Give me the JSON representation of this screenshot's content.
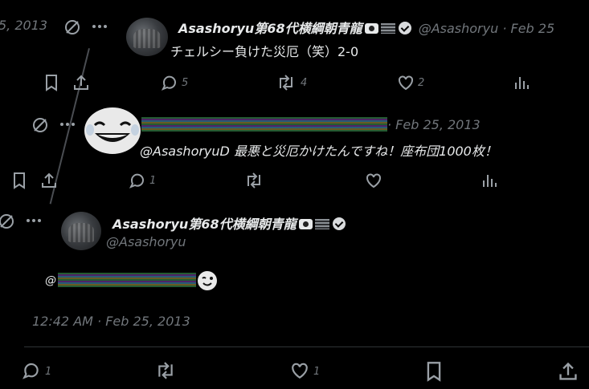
{
  "tweet1": {
    "edge_date": "5, 2013",
    "name": "Asashoryu第68代横綱朝青龍",
    "handle": "@Asashoryu",
    "date": "· Feb 25",
    "text": "チェルシー負けた災厄（笑）2-0",
    "replies": "5",
    "retweets": "4",
    "likes": "2"
  },
  "tweet2": {
    "date": "· Feb 25, 2013",
    "text": "@AsashoryuD 最悪と災厄かけたんですね！座布団1000枚！",
    "replies": "1"
  },
  "tweet3": {
    "name": "Asashoryu第68代横綱朝青龍",
    "handle": "@Asashoryu",
    "mention_prefix": "@",
    "timestamp": "12:42 AM · Feb 25, 2013",
    "replies": "1",
    "likes": "1"
  },
  "icons": {
    "more": "more-icon",
    "share": "share-icon",
    "bookmark": "bookmark-icon",
    "reply": "reply-icon",
    "retweet": "retweet-icon",
    "like": "like-icon",
    "views": "views-icon",
    "no-sign": "no-sign-icon"
  }
}
